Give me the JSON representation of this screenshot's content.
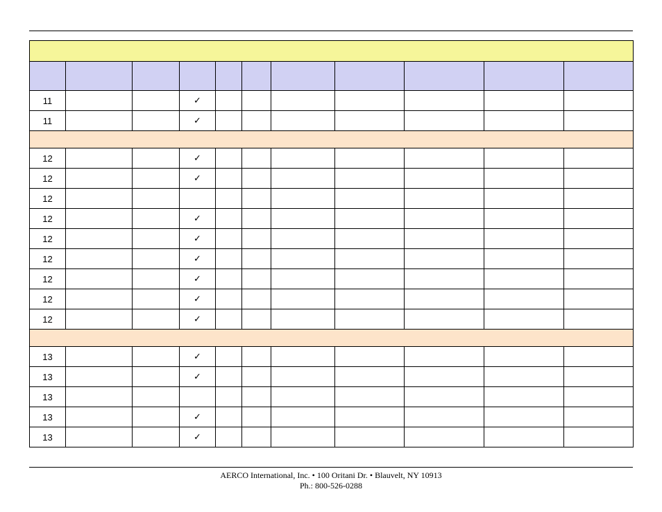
{
  "check_glyph": "✓",
  "sections": [
    {
      "rows": [
        {
          "no": "11",
          "check": true
        },
        {
          "no": "11",
          "check": true
        }
      ]
    },
    {
      "rows": [
        {
          "no": "12",
          "check": true
        },
        {
          "no": "12",
          "check": true
        },
        {
          "no": "12",
          "check": false
        },
        {
          "no": "12",
          "check": true
        },
        {
          "no": "12",
          "check": true
        },
        {
          "no": "12",
          "check": true
        },
        {
          "no": "12",
          "check": true
        },
        {
          "no": "12",
          "check": true
        },
        {
          "no": "12",
          "check": true
        }
      ]
    },
    {
      "rows": [
        {
          "no": "13",
          "check": true
        },
        {
          "no": "13",
          "check": true
        },
        {
          "no": "13",
          "check": false
        },
        {
          "no": "13",
          "check": true
        },
        {
          "no": "13",
          "check": true
        }
      ]
    }
  ],
  "footer": {
    "line1": "AERCO International, Inc. • 100 Oritani Dr. •  Blauvelt, NY 10913",
    "line2": "Ph.: 800-526-0288"
  }
}
